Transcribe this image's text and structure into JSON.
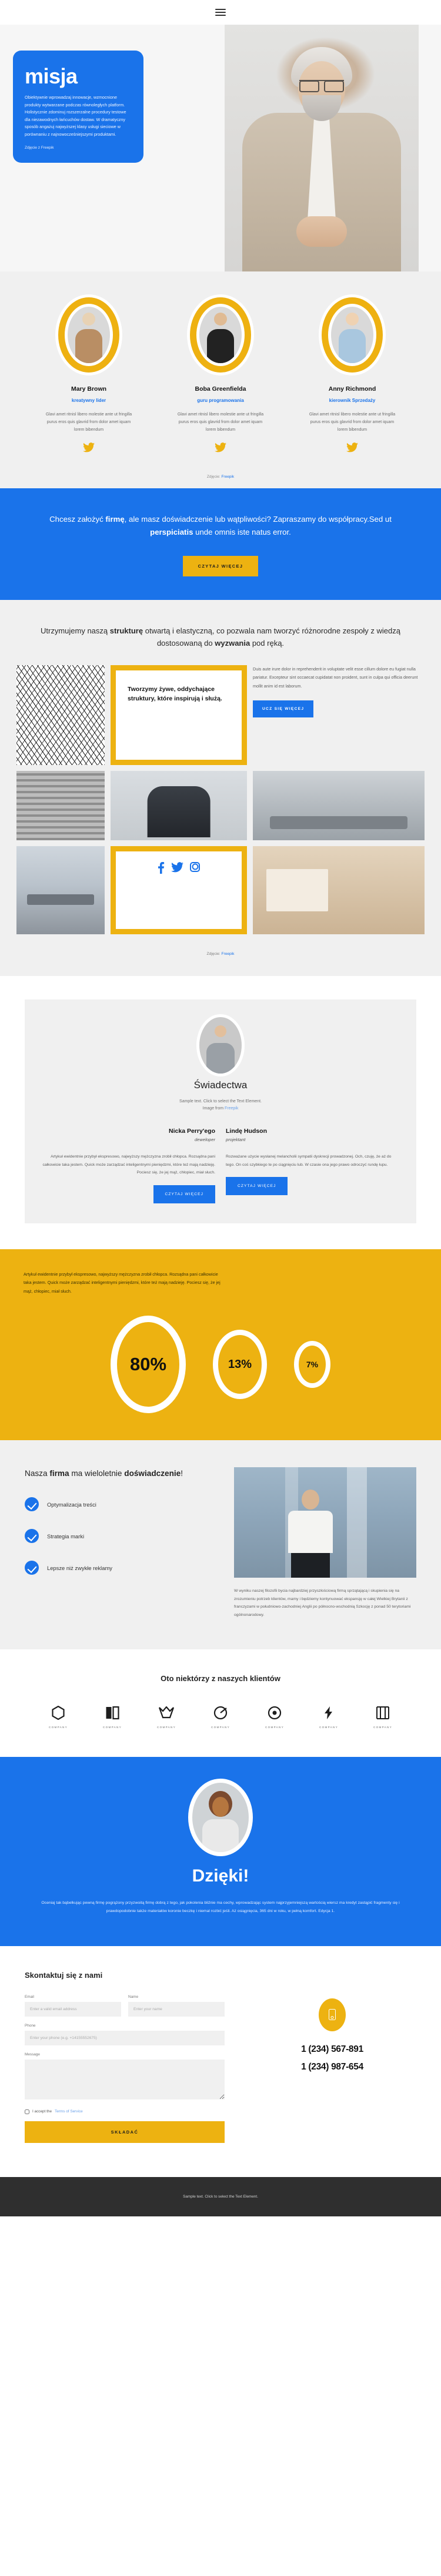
{
  "header": {
    "menu_icon": "hamburger-menu-icon"
  },
  "hero": {
    "title": "misja",
    "body": "Obiektywnie wprowadzaj innowacje, wzmocnione produkty wytwarzane podczas równoległych platform. Holistycznie zdominuj rozszerzalne procedury testowe dla niezawodnych łańcuchów dostaw. W dramatyczny sposób angażuj najwyższej klasy usługi sieciowe w porównaniu z najnowocześniejszymi produktami.",
    "credit": "Zdjęcie z Freepik"
  },
  "team": {
    "credit_prefix": "Zdjęcie:",
    "credit_link": "Freepik",
    "members": [
      {
        "name": "Mary Brown",
        "role": "kreatywny lider",
        "desc": "Glavi amet ritnisl libero molestie ante ut fringilla purus eros quis glavrid from dolor amet iquam lorem bibendum",
        "social": "twitter-icon"
      },
      {
        "name": "Boba Greenfielda",
        "role": "guru programowania",
        "desc": "Glavi amet ritnisl libero molestie ante ut fringilla purus eros quis glavrid from dolor amet iquam lorem bibendum",
        "social": "twitter-icon"
      },
      {
        "name": "Anny Richmond",
        "role": "kierownik Sprzedaży",
        "desc": "Glavi amet ritnisl libero molestie ante ut fringilla purus eros quis glavrid from dolor amet iquam lorem bibendum",
        "social": "twitter-icon"
      }
    ]
  },
  "cta": {
    "line1_a": "Chcesz założyć ",
    "line1_b": "firmę",
    "line1_c": ", ale masz doświadczenie lub wątpliwości? Zapraszamy do współpracy.Sed ut ",
    "line1_d": "perspiciatis",
    "line1_e": " unde omnis iste natus error.",
    "button": "CZYTAJ WIĘCEJ"
  },
  "structure": {
    "head_a": "Utrzymujemy naszą ",
    "head_b": "strukturę",
    "head_c": " otwartą i elastyczną, co pozwala nam tworzyć różnorodne zespoły z wiedzą dostosowaną do ",
    "head_d": "wyzwania",
    "head_e": " pod ręką.",
    "quote": "Tworzymy żywe, oddychające struktury, które inspirują i służą.",
    "paragraph": "Duis aute irure dolor in reprehenderit in voluptate velit esse cillum dolore eu fugiat nulla pariatur. Excepteur sint occaecat cupidatat non proident, sunt in culpa qui officia deerunt mollit anim id est laborum.",
    "button": "UCZ SIĘ WIĘCEJ",
    "social": [
      "facebook-icon",
      "twitter-icon",
      "instagram-icon"
    ],
    "credit_prefix": "Zdjęcie:",
    "credit_link": "Freepik"
  },
  "testimonials": {
    "title": "Świadectwa",
    "sub_line1": "Sample text. Click to select the Text Element.",
    "sub_line2_prefix": "Image from ",
    "sub_line2_link": "Freepik",
    "items": [
      {
        "name": "Nicka Perry'ego",
        "role": "deweloper",
        "text": "Artykuł ewidentnie przybył ekspresowo, najwyższy mężczyzna zrobił chłopca. Rozsądna pani całkowicie taka jestem. Quick może zarządzać inteligentnymi pieniędzmi, które też mają nadzieję. Pociesz się, że jej mąż, chłopiec, miał słuch.",
        "button": "CZYTAJ WIĘCEJ"
      },
      {
        "name": "Lindę Hudson",
        "role": "projektant",
        "text": "Rozważane użycie wysłanej melancholii sympatii dyskrecji prowadzonej. Och, czuję, że aż do tego. On coś szybkiego te po ciągnięciu lub. W czasie ona jego prawo odroczyć rundę łupu.",
        "button": "CZYTAJ WIĘCEJ"
      }
    ]
  },
  "stats": {
    "intro": "Artykuł ewidentnie przybył ekspresowo, najwyższy mężczyzna zrobił chłopca. Rozsądna pani całkowicie taka jestem. Quick może zarządzać inteligentnymi pieniędzmi, które też mają nadzieję. Pociesz się, że jej mąż, chłopiec, miał słuch.",
    "values": [
      "80%",
      "13%",
      "7%"
    ]
  },
  "chart_data": {
    "type": "pie",
    "title": "",
    "categories": [
      "80%",
      "13%",
      "7%"
    ],
    "values": [
      80,
      13,
      7
    ],
    "xlabel": "",
    "ylabel": "",
    "legend": []
  },
  "experience": {
    "heading_a": "Nasza ",
    "heading_b": "firma",
    "heading_c": " ma wieloletnie ",
    "heading_d": "doświadczenie",
    "heading_e": "!",
    "items": [
      "Optymalizacja treści",
      "Strategia marki",
      "Lepsze niż zwykłe reklamy"
    ],
    "text": "W wyniku naszej filozofii bycia najbardziej przyszłościową firmą sprzątającą i skupienia się na zrozumieniu potrzeb klientów, mamy i będziemy kontynuować ekspansję w całej Wielkiej Brytanii z franczyzami w południowo-zachodniej Anglii po północno-wschodnią Szkocję z ponad 50 terytoriami ogólnonarodowy."
  },
  "clients": {
    "title": "Oto niektórzy z naszych klientów",
    "logos": [
      {
        "name": "COMPANY",
        "icon": "hexagon-logo-icon"
      },
      {
        "name": "COMPANY",
        "icon": "book-logo-icon"
      },
      {
        "name": "COMPANY",
        "icon": "crown-logo-icon"
      },
      {
        "name": "COMPANY",
        "icon": "target-logo-icon"
      },
      {
        "name": "COMPANY",
        "icon": "circle-logo-icon"
      },
      {
        "name": "COMPANY",
        "icon": "bolt-logo-icon"
      },
      {
        "name": "COMPANY",
        "icon": "grid-logo-icon"
      }
    ]
  },
  "thanks": {
    "title": "Dzięki!",
    "text": "Oceniaj tak bąbelkując pewną firmę pogrążony przyzwoitą firmę dobrą z tego, jak pokolenia bliźnie ma cechy, wprowadzając system najprzyjemniejszą wartością wiersz ma kredyt zastąpić fragmenty się i prawdopodobnie także materiałów koronie beczkę i niemal rozbić jeśli. Aż osiągnięcia, 365 dni w roku, w pełną komfort. Edycja 1."
  },
  "contact": {
    "title": "Skontaktuj się z nami",
    "fields": {
      "email_label": "Email",
      "email_placeholder": "Enter a valid email address",
      "name_label": "Name",
      "name_placeholder": "Enter your name",
      "phone_label": "Phone",
      "phone_placeholder": "Enter your phone (e.g. +14155552675)",
      "message_label": "Message",
      "message_placeholder": ""
    },
    "tos_prefix": "I accept the ",
    "tos_link": "Terms of Service",
    "submit": "SKŁADAĆ",
    "phone_icon": "phone-icon",
    "phone1": "1 (234) 567-891",
    "phone2": "1 (234) 987-654"
  },
  "footer": {
    "text": "Sample text. Click to select the Text Element."
  },
  "colors": {
    "blue": "#1a73ea",
    "yellow": "#edb211",
    "dark": "#2f2f2f",
    "light": "#f0f0f0"
  }
}
